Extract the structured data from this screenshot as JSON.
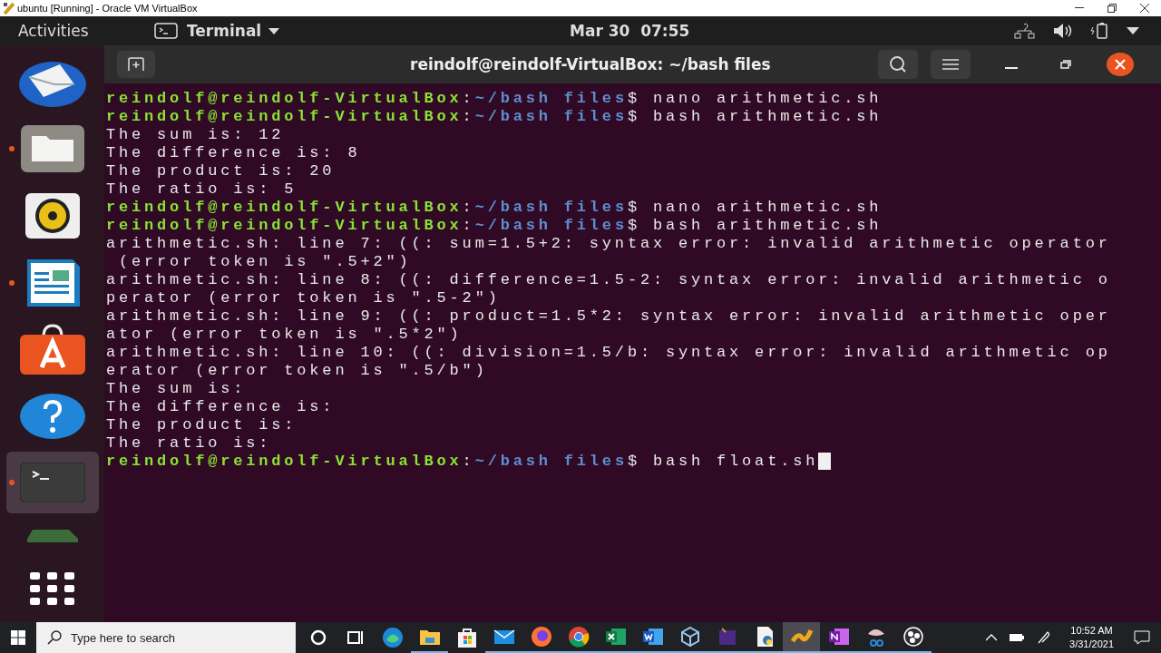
{
  "host_window": {
    "title": "ubuntu [Running] - Oracle VM VirtualBox"
  },
  "top_bar": {
    "activities": "Activities",
    "app_menu": "Terminal",
    "clock": "Mar 30  07:55"
  },
  "dock": {
    "items": [
      {
        "kind": "mail",
        "running": false,
        "selected": false
      },
      {
        "kind": "files",
        "running": true,
        "selected": false
      },
      {
        "kind": "music",
        "running": false,
        "selected": false
      },
      {
        "kind": "writer",
        "running": true,
        "selected": false
      },
      {
        "kind": "software",
        "running": false,
        "selected": false
      },
      {
        "kind": "help",
        "running": false,
        "selected": false
      },
      {
        "kind": "terminal",
        "running": true,
        "selected": true
      },
      {
        "kind": "drive",
        "running": false,
        "selected": false
      },
      {
        "kind": "apps",
        "running": false,
        "selected": false
      }
    ]
  },
  "terminal": {
    "title": "reindolf@reindolf-VirtualBox: ~/bash files",
    "lines": [
      {
        "kind": "prompt",
        "user": "reindolf@reindolf-VirtualBox",
        "separator": ":",
        "path": "~/bash files",
        "symbol": "$",
        "command": "nano arithmetic.sh",
        "cursor": false
      },
      {
        "kind": "prompt",
        "user": "reindolf@reindolf-VirtualBox",
        "separator": ":",
        "path": "~/bash files",
        "symbol": "$",
        "command": "bash arithmetic.sh",
        "cursor": false
      },
      {
        "kind": "output",
        "text": "The sum is: 12"
      },
      {
        "kind": "output",
        "text": "The difference is: 8"
      },
      {
        "kind": "output",
        "text": "The product is: 20"
      },
      {
        "kind": "output",
        "text": "The ratio is: 5"
      },
      {
        "kind": "prompt",
        "user": "reindolf@reindolf-VirtualBox",
        "separator": ":",
        "path": "~/bash files",
        "symbol": "$",
        "command": "nano arithmetic.sh",
        "cursor": false
      },
      {
        "kind": "prompt",
        "user": "reindolf@reindolf-VirtualBox",
        "separator": ":",
        "path": "~/bash files",
        "symbol": "$",
        "command": "bash arithmetic.sh",
        "cursor": false
      },
      {
        "kind": "output",
        "text": "arithmetic.sh: line 7: ((: sum=1.5+2: syntax error: invalid arithmetic operator"
      },
      {
        "kind": "output",
        "text": " (error token is \".5+2\")"
      },
      {
        "kind": "output",
        "text": "arithmetic.sh: line 8: ((: difference=1.5-2: syntax error: invalid arithmetic o"
      },
      {
        "kind": "output",
        "text": "perator (error token is \".5-2\")"
      },
      {
        "kind": "output",
        "text": "arithmetic.sh: line 9: ((: product=1.5*2: syntax error: invalid arithmetic oper"
      },
      {
        "kind": "output",
        "text": "ator (error token is \".5*2\")"
      },
      {
        "kind": "output",
        "text": "arithmetic.sh: line 10: ((: division=1.5/b: syntax error: invalid arithmetic op"
      },
      {
        "kind": "output",
        "text": "erator (error token is \".5/b\")"
      },
      {
        "kind": "output",
        "text": "The sum is:"
      },
      {
        "kind": "output",
        "text": "The difference is:"
      },
      {
        "kind": "output",
        "text": "The product is:"
      },
      {
        "kind": "output",
        "text": "The ratio is:"
      },
      {
        "kind": "prompt",
        "user": "reindolf@reindolf-VirtualBox",
        "separator": ":",
        "path": "~/bash files",
        "symbol": "$",
        "command": "bash float.sh",
        "cursor": true
      }
    ]
  },
  "taskbar": {
    "search": {
      "placeholder": "Type here to search"
    },
    "apps": [
      {
        "kind": "cortana",
        "running": false,
        "selected": false
      },
      {
        "kind": "taskview",
        "running": false,
        "selected": false
      },
      {
        "kind": "edge",
        "running": false,
        "selected": false
      },
      {
        "kind": "explorer",
        "running": true,
        "selected": false
      },
      {
        "kind": "store",
        "running": false,
        "selected": false
      },
      {
        "kind": "mail",
        "running": true,
        "selected": false
      },
      {
        "kind": "firefox",
        "running": true,
        "selected": false
      },
      {
        "kind": "chrome",
        "running": true,
        "selected": false
      },
      {
        "kind": "excel",
        "running": true,
        "selected": false
      },
      {
        "kind": "word",
        "running": true,
        "selected": false
      },
      {
        "kind": "virtualbox",
        "running": true,
        "selected": false
      },
      {
        "kind": "tex",
        "running": true,
        "selected": false
      },
      {
        "kind": "script",
        "running": true,
        "selected": false
      },
      {
        "kind": "pen",
        "running": true,
        "selected": true
      },
      {
        "kind": "onenote",
        "running": true,
        "selected": false
      },
      {
        "kind": "snip",
        "running": true,
        "selected": false
      },
      {
        "kind": "obs",
        "running": true,
        "selected": false
      }
    ],
    "time": "10:52 AM",
    "date": "3/31/2021"
  }
}
